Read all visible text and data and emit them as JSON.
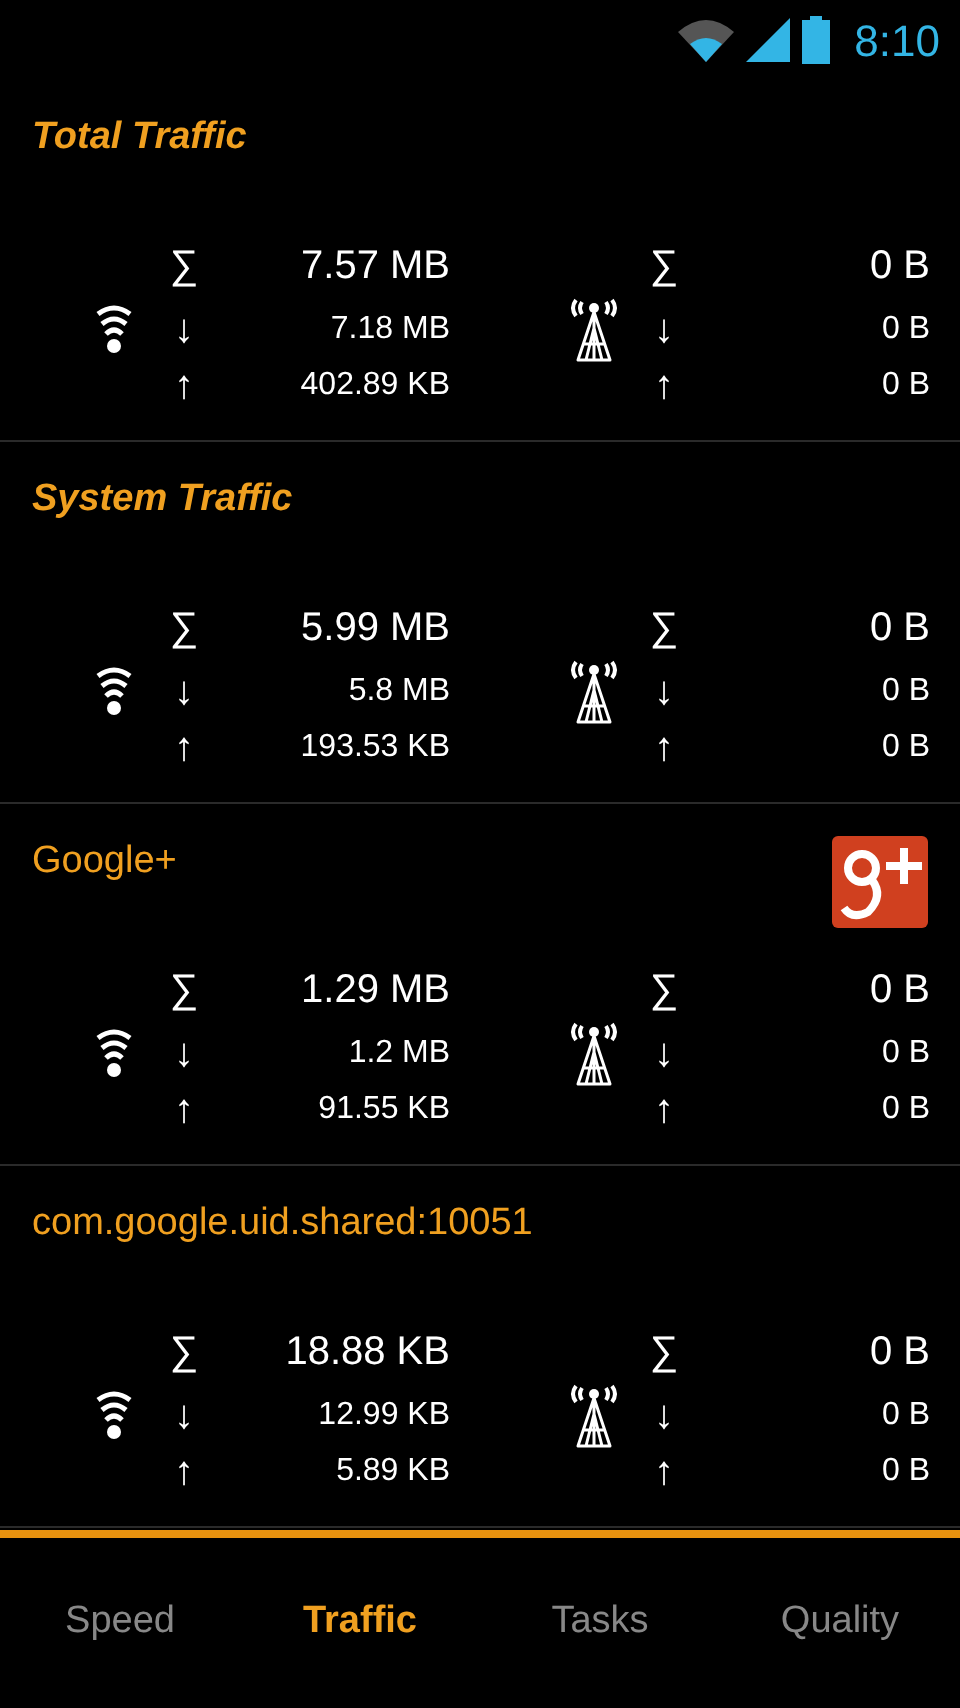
{
  "status_bar": {
    "time": "8:10"
  },
  "sections": [
    {
      "kind": "summary",
      "title": "Total Traffic",
      "has_icon": false,
      "wifi": {
        "total": "7.57 MB",
        "down": "7.18 MB",
        "up": "402.89 KB"
      },
      "mobile": {
        "total": "0 B",
        "down": "0 B",
        "up": "0 B"
      }
    },
    {
      "kind": "summary",
      "title": "System Traffic",
      "has_icon": false,
      "wifi": {
        "total": "5.99 MB",
        "down": "5.8 MB",
        "up": "193.53 KB"
      },
      "mobile": {
        "total": "0 B",
        "down": "0 B",
        "up": "0 B"
      }
    },
    {
      "kind": "app",
      "title": "Google+",
      "has_icon": true,
      "wifi": {
        "total": "1.29 MB",
        "down": "1.2 MB",
        "up": "91.55 KB"
      },
      "mobile": {
        "total": "0 B",
        "down": "0 B",
        "up": "0 B"
      }
    },
    {
      "kind": "app",
      "title": "com.google.uid.shared:10051",
      "has_icon": false,
      "wifi": {
        "total": "18.88 KB",
        "down": "12.99 KB",
        "up": "5.89 KB"
      },
      "mobile": {
        "total": "0 B",
        "down": "0 B",
        "up": "0 B"
      }
    }
  ],
  "symbols": {
    "total": "∑",
    "down": "↓",
    "up": "↑"
  },
  "tabs": [
    {
      "label": "Speed",
      "selected": false
    },
    {
      "label": "Traffic",
      "selected": true
    },
    {
      "label": "Tasks",
      "selected": false
    },
    {
      "label": "Quality",
      "selected": false
    }
  ]
}
